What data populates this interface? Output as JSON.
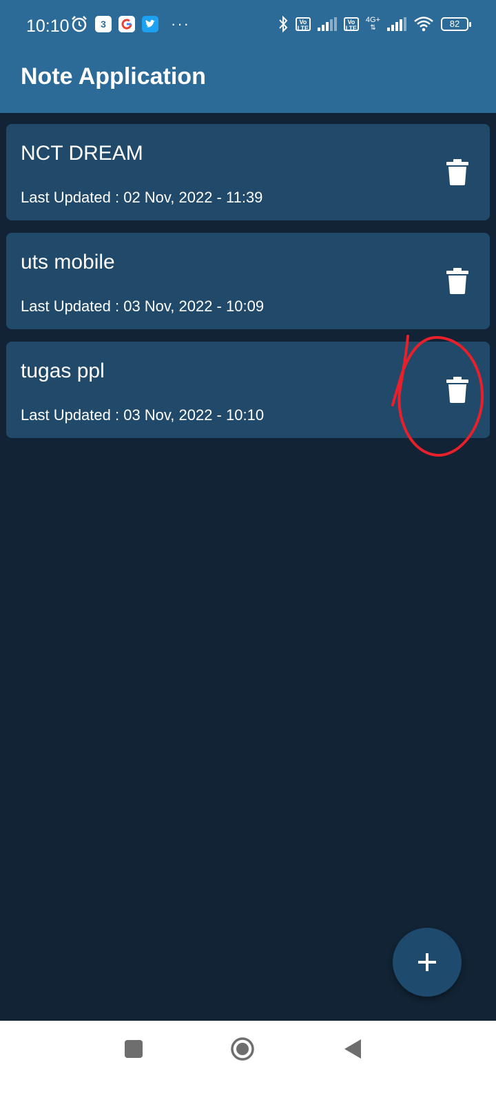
{
  "status_bar": {
    "time": "10:10",
    "calendar_day": "3",
    "battery": "82",
    "network_label": "4G+",
    "volte_label": "Vo LTE"
  },
  "app_bar": {
    "title": "Note Application"
  },
  "notes": [
    {
      "title": "NCT DREAM",
      "updated": "Last Updated : 02 Nov, 2022 - 11:39"
    },
    {
      "title": "uts mobile",
      "updated": "Last Updated : 03 Nov, 2022 - 10:09"
    },
    {
      "title": "tugas ppl",
      "updated": "Last Updated : 03 Nov, 2022 - 10:10"
    }
  ],
  "icons": {
    "delete": "trash-icon",
    "add": "plus-icon",
    "nav_recents": "square-icon",
    "nav_home": "circle-icon",
    "nav_back": "triangle-back-icon"
  },
  "colors": {
    "app_bar": "#2c6b98",
    "background": "#112334",
    "card": "#214a6a",
    "fab": "#1d4a6d",
    "annotation": "#e8202a"
  }
}
